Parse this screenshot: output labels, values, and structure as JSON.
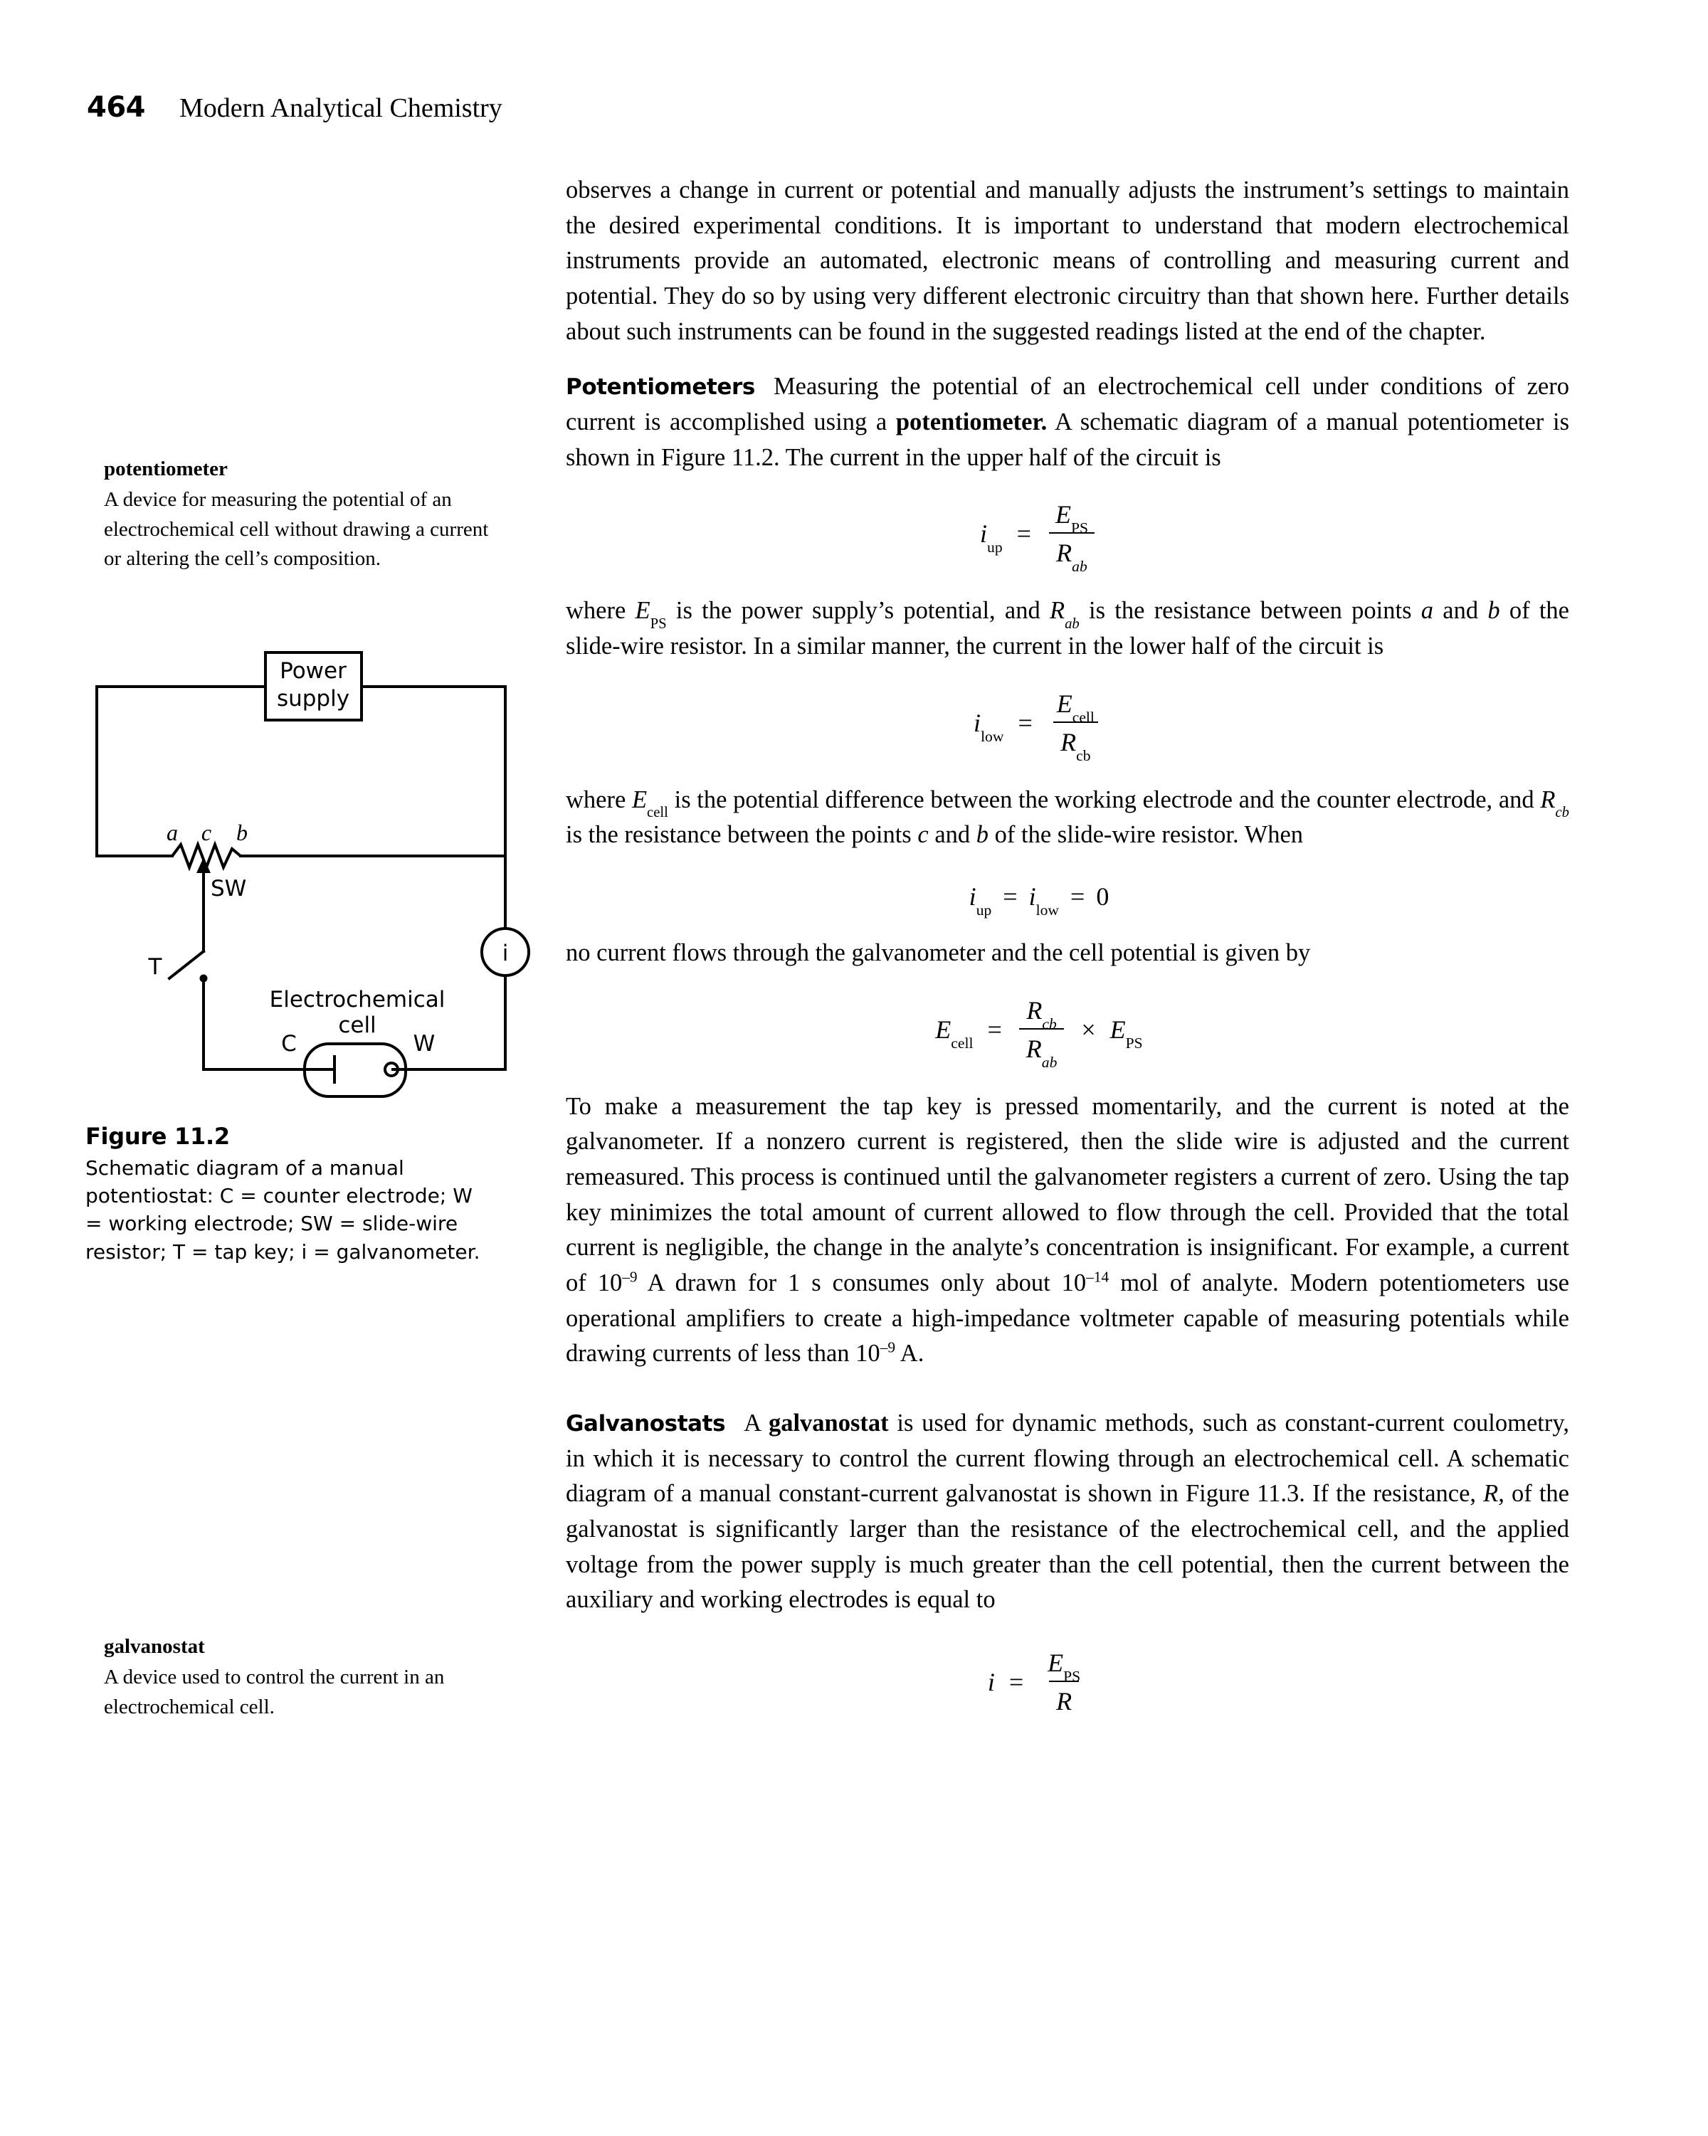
{
  "header": {
    "page_number": "464",
    "book_title": "Modern Analytical Chemistry"
  },
  "sidebar": {
    "notes": [
      {
        "term": "potentiometer",
        "definition": "A device for measuring the potential of an electrochemical cell without drawing a current or altering the cell’s composition."
      },
      {
        "term": "galvanostat",
        "definition": "A device used to control the current in an electrochemical cell."
      }
    ]
  },
  "figure": {
    "label": "Figure 11.2",
    "caption": "Schematic diagram of a manual potentiostat: C = counter electrode; W = working electrode; SW = slide-wire resistor; T = tap key; i = galvanometer.",
    "power_supply_line1": "Power",
    "power_supply_line2": "supply",
    "node_a": "a",
    "node_c": "c",
    "node_b": "b",
    "slide_wire_label": "SW",
    "tap_key_label": "T",
    "galvanometer_label": "i",
    "cell_line1": "Electrochemical",
    "cell_line2": "cell",
    "counter_electrode": "C",
    "working_electrode": "W"
  },
  "main": {
    "para_intro": "observes a change in current or potential and manually adjusts the instrument’s settings to maintain the desired experimental conditions. It is important to understand that modern electrochemical instruments provide an automated, electronic means of controlling and measuring current and potential. They do so by using very different electronic circuitry than that shown here. Further details about such instruments can be found in the suggested readings listed at the end of the chapter.",
    "potentiometers_heading": "Potentiometers",
    "para_potentiometers_a": "Measuring the potential of an electrochemical cell under conditions of zero current is accomplished using a ",
    "para_potentiometers_bold": "potentiometer.",
    "para_potentiometers_b": " A schematic diagram of a manual potentiometer is shown in Figure 11.2. The current in the upper half of the circuit is",
    "para_where_ps_1": "where ",
    "para_where_ps_2": " is the power supply’s potential, and ",
    "para_where_ps_3": " is the resistance between points ",
    "para_where_ps_4": " and ",
    "para_where_ps_5": " of the slide-wire resistor. In a similar manner, the current in the lower half of the circuit is",
    "para_where_cell_1": "where ",
    "para_where_cell_2": " is the potential difference between the working electrode and the counter electrode, and ",
    "para_where_cell_3": " is the resistance between the points ",
    "para_where_cell_4": " and ",
    "para_where_cell_5": " of the slide-wire resistor. When",
    "para_no_current": "no current flows through the galvanometer and the cell potential is given by",
    "para_measurement_1": "To make a measurement the tap key is pressed momentarily, and the current is noted at the galvanometer. If a nonzero current is registered, then the slide wire is adjusted and the current remeasured. This process is continued until the galvanometer registers a current of zero. Using the tap key minimizes the total amount of current allowed to flow through the cell. Provided that the total current is negligible, the change in the analyte’s concentration is insignificant. For example, a current of 10",
    "para_measurement_exp1": "–9",
    "para_measurement_2": " A drawn for 1 s consumes only about 10",
    "para_measurement_exp2": "–14",
    "para_measurement_3": " mol of analyte. Modern potentiometers use operational amplifiers to create a high-impedance voltmeter capable of measuring potentials while drawing currents of less than 10",
    "para_measurement_exp3": "–9",
    "para_measurement_4": " A.",
    "galvanostats_heading": "Galvanostats",
    "para_galvanostats_1": "A ",
    "para_galvanostats_bold": "galvanostat",
    "para_galvanostats_2": " is used for dynamic methods, such as constant-current coulometry, in which it is necessary to control the current flowing through an electrochemical cell. A schematic diagram of a manual constant-current galvanostat is shown in Figure 11.3. If the resistance, ",
    "para_galvanostats_R": "R,",
    "para_galvanostats_3": " of the galvanostat is significantly larger than the resistance of the electrochemical cell, and the applied voltage from the power supply is much greater than the cell potential, then the current between the auxiliary and working electrodes is equal to"
  },
  "equations": {
    "eq1": {
      "lhs_var": "i",
      "lhs_sub": "up",
      "op": "=",
      "num_var": "E",
      "num_sub": "PS",
      "den_var": "R",
      "den_sub": "ab"
    },
    "eq2": {
      "lhs_var": "i",
      "lhs_sub": "low",
      "op": "=",
      "num_var": "E",
      "num_sub": "cell",
      "den_var": "R",
      "den_sub": "cb"
    },
    "eq3": {
      "lhs_var": "i",
      "lhs_sub": "up",
      "op1": "=",
      "mid_var": "i",
      "mid_sub": "low",
      "op2": "=",
      "rhs": "0"
    },
    "eq4": {
      "lhs_var": "E",
      "lhs_sub": "cell",
      "op": "=",
      "num_var": "R",
      "num_sub": "cb",
      "den_var": "R",
      "den_sub": "ab",
      "times": "×",
      "rhs_var": "E",
      "rhs_sub": "PS"
    },
    "eq5": {
      "lhs_var": "i",
      "op": "=",
      "num_var": "E",
      "num_sub": "PS",
      "den_var": "R"
    }
  },
  "colors": {
    "ink": "#000000",
    "paper": "#ffffff"
  }
}
